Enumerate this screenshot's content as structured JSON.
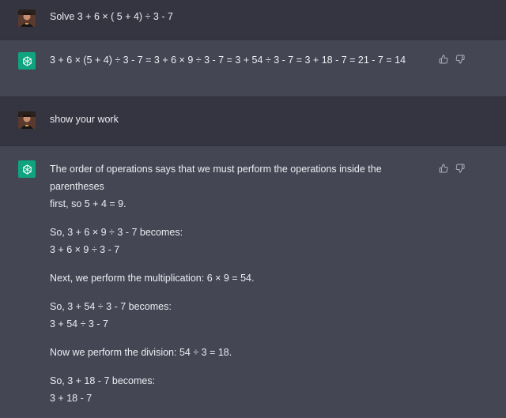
{
  "conversation": {
    "q1": "Solve 3 + 6 × ( 5 + 4) ÷ 3 - 7",
    "a1": "3 + 6 × (5 + 4) ÷ 3 - 7 = 3 + 6 × 9 ÷ 3 - 7 = 3 + 54 ÷ 3 - 7 = 3 + 18 - 7 = 21 - 7 = 14",
    "q2": "show your work",
    "a2": {
      "p1_l1": "The order of operations says that we must perform the operations inside the parentheses",
      "p1_l2": "first, so 5 + 4 = 9.",
      "p2_l1": "So, 3 + 6 × 9 ÷ 3 - 7 becomes:",
      "p2_l2": "3 + 6 × 9 ÷ 3 - 7",
      "p3_l1": "Next, we perform the multiplication: 6 × 9 = 54.",
      "p4_l1": "So, 3 + 54 ÷ 3 - 7 becomes:",
      "p4_l2": "3 + 54 ÷ 3 - 7",
      "p5_l1": "Now we perform the division: 54 ÷ 3 = 18.",
      "p6_l1": "So, 3 + 18 - 7 becomes:",
      "p6_l2": "3 + 18 - 7"
    }
  },
  "icons": {
    "user_avatar": "user-avatar",
    "assistant_avatar": "openai-logo-icon",
    "thumbs_up": "thumbs-up-icon",
    "thumbs_down": "thumbs-down-icon"
  },
  "colors": {
    "user_bg": "#343541",
    "assistant_bg": "#444654",
    "brand": "#10a37f",
    "text": "#ececf1",
    "icon": "#acacbe"
  }
}
